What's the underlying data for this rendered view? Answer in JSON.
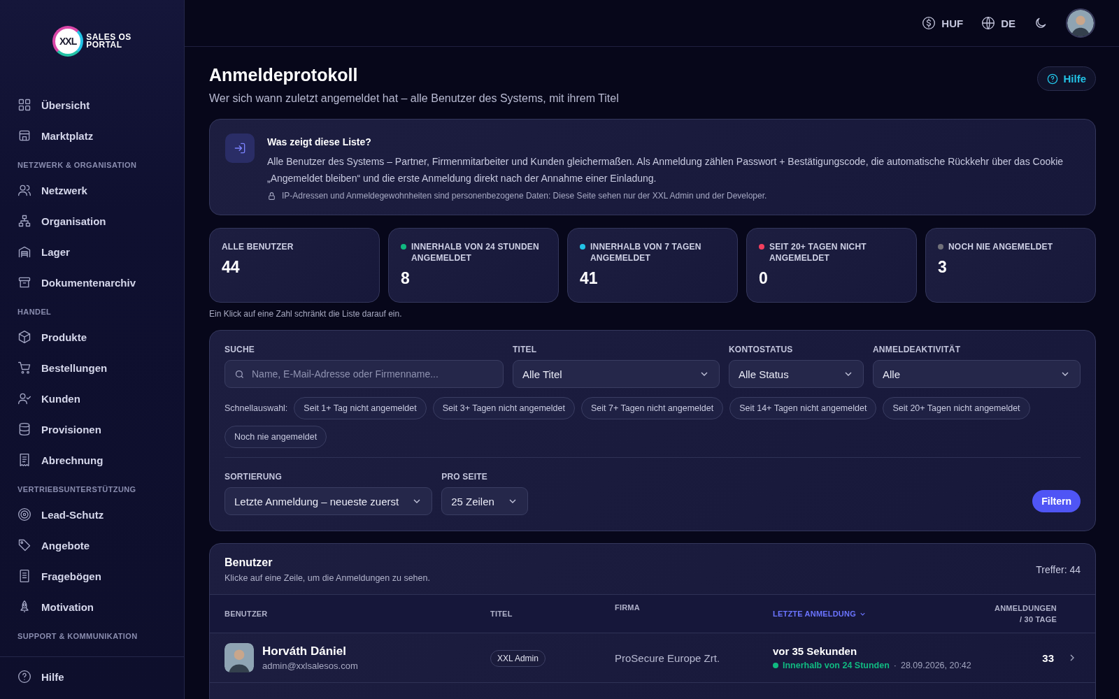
{
  "logo": {
    "mark": "XXL",
    "line1": "SALES OS",
    "line2": "PORTAL"
  },
  "sidebar": {
    "groups": [
      {
        "items": [
          {
            "label": "Übersicht"
          },
          {
            "label": "Marktplatz"
          }
        ]
      },
      {
        "heading": "NETZWERK & ORGANISATION",
        "items": [
          {
            "label": "Netzwerk"
          },
          {
            "label": "Organisation"
          },
          {
            "label": "Lager"
          },
          {
            "label": "Dokumentenarchiv"
          }
        ]
      },
      {
        "heading": "HANDEL",
        "items": [
          {
            "label": "Produkte"
          },
          {
            "label": "Bestellungen"
          },
          {
            "label": "Kunden"
          },
          {
            "label": "Provisionen"
          },
          {
            "label": "Abrechnung"
          }
        ]
      },
      {
        "heading": "VERTRIEBSUNTERSTÜTZUNG",
        "items": [
          {
            "label": "Lead-Schutz"
          },
          {
            "label": "Angebote"
          },
          {
            "label": "Fragebögen"
          },
          {
            "label": "Motivation"
          }
        ]
      },
      {
        "heading": "SUPPORT & KOMMUNIKATION"
      }
    ],
    "footer": {
      "label": "Hilfe"
    }
  },
  "topbar": {
    "currency": "HUF",
    "language": "DE"
  },
  "page": {
    "title": "Anmeldeprotokoll",
    "subtitle": "Wer sich wann zuletzt angemeldet hat – alle Benutzer des Systems, mit ihrem Titel",
    "help": "Hilfe"
  },
  "info": {
    "title": "Was zeigt diese Liste?",
    "text": "Alle Benutzer des Systems – Partner, Firmenmitarbeiter und Kunden gleichermaßen. Als Anmeldung zählen Passwort + Bestätigungscode, die automatische Rückkehr über das Cookie „Angemeldet bleiben“ und die erste Anmeldung direkt nach der Annahme einer Einladung.",
    "note": "IP-Adressen und Anmeldegewohnheiten sind personenbezogene Daten: Diese Seite sehen nur der XXL Admin und der Developer."
  },
  "stats": [
    {
      "label": "ALLE BENUTZER",
      "value": "44"
    },
    {
      "label": "INNERHALB VON 24 STUNDEN ANGEMELDET",
      "value": "8",
      "color": "#10b981"
    },
    {
      "label": "INNERHALB VON 7 TAGEN ANGEMELDET",
      "value": "41",
      "color": "#22c3e6"
    },
    {
      "label": "SEIT 20+ TAGEN NICHT ANGEMELDET",
      "value": "0",
      "color": "#f43f5e"
    },
    {
      "label": "NOCH NIE ANGEMELDET",
      "value": "3",
      "color": "#71717a"
    }
  ],
  "stats_hint": "Ein Klick auf eine Zahl schränkt die Liste darauf ein.",
  "filters": {
    "search": {
      "label": "SUCHE",
      "placeholder": "Name, E-Mail-Adresse oder Firmenname..."
    },
    "selects": [
      {
        "label": "TITEL",
        "value": "Alle Titel"
      },
      {
        "label": "KONTOSTATUS",
        "value": "Alle Status"
      },
      {
        "label": "ANMELDEAKTIVITÄT",
        "value": "Alle"
      }
    ],
    "quick_label": "Schnellauswahl:",
    "quick": [
      "Seit 1+ Tag nicht angemeldet",
      "Seit 3+ Tagen nicht angemeldet",
      "Seit 7+ Tagen nicht angemeldet",
      "Seit 14+ Tagen nicht angemeldet",
      "Seit 20+ Tagen nicht angemeldet",
      "Noch nie angemeldet"
    ],
    "sort": {
      "label": "SORTIERUNG",
      "value": "Letzte Anmeldung – neueste zuerst"
    },
    "per_page": {
      "label": "PRO SEITE",
      "value": "25 Zeilen"
    },
    "submit": "Filtern"
  },
  "table": {
    "title": "Benutzer",
    "subtitle": "Klicke auf eine Zeile, um die Anmeldungen zu sehen.",
    "count": "Treffer: 44",
    "columns": [
      {
        "label": "BENUTZER",
        "sorted": false
      },
      {
        "label": "TITEL",
        "sorted": false
      },
      {
        "label": "FIRMA",
        "sorted": false
      },
      {
        "label": "LETZTE ANMELDUNG",
        "sorted": true
      },
      {
        "label": "ANMELDUNGEN / 30 TAGE",
        "sorted": false
      }
    ],
    "rows": [
      {
        "name": "Horváth Dániel",
        "email": "admin@xxlsalesos.com",
        "title": "XXL Admin",
        "company": "ProSecure Europe Zrt.",
        "last": "vor 35 Sekunden",
        "status": "Innerhalb von 24 Stunden",
        "color": "#10b981",
        "separator": "·",
        "date": "28.09.2026, 20:42",
        "logins": "33"
      }
    ]
  }
}
